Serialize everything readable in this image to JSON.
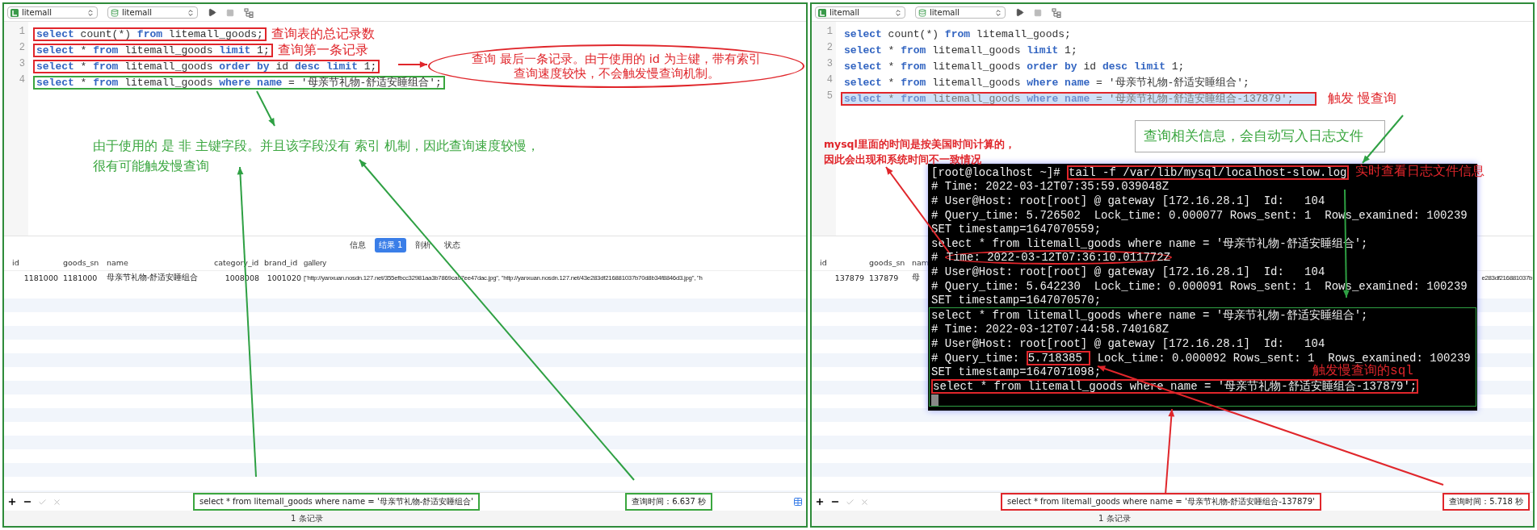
{
  "panels": [
    {
      "toolbar": {
        "connection": "litemall",
        "database": "litemall"
      },
      "editor": {
        "lines": [
          {
            "number": "1",
            "selected": false,
            "color": "#e0262b",
            "note": "查询表的总记录数",
            "text": "**select** count(*) **from** litemall_goods;"
          },
          {
            "number": "2",
            "selected": false,
            "color": "#e0262b",
            "note": "查询第一条记录",
            "text": "**select** * **from** litemall_goods **limit** 1;"
          },
          {
            "number": "3",
            "selected": false,
            "color": "#e0262b",
            "text": "**select** * **from** litemall_goods **order by** id **desc** **limit** 1;"
          },
          {
            "number": "4",
            "selected": false,
            "color": "#3aa63f",
            "text": "**select** * **from** litemall_goods **where** **name** = '母亲节礼物-舒适安睡组合';"
          }
        ]
      },
      "callouts": [
        {
          "kind": "ellipse",
          "color": "#e0262b",
          "lines": [
            "查询 最后一条记录。由于使用的 id 为主键，带有索引",
            "查询速度较快，不会触发慢查询机制。"
          ]
        },
        {
          "kind": "plain",
          "color": "#3aa63f",
          "lines": [
            "由于使用的 是 非 主键字段。并且该字段没有 索引 机制，因此查询速度较慢，",
            "很有可能触发慢查询"
          ]
        }
      ],
      "result_tabs": [
        {
          "label": "信息",
          "selected": false
        },
        {
          "label": "结果 1",
          "selected": true
        },
        {
          "label": "剖析",
          "selected": false
        },
        {
          "label": "状态",
          "selected": false
        }
      ],
      "table": {
        "columns": [
          "id",
          "goods_sn",
          "name",
          "category_id",
          "brand_id",
          "gallery"
        ],
        "rows": [
          {
            "cells": [
              "1181000",
              "1181000",
              "母亲节礼物-舒适安睡组合",
              "1008008",
              "1001020",
              "[\"http://yanxuan.nosdn.127.net/355efbcc32981aa3b7869ca07ee47dac.jpg\", \"http://yanxuan.nosdn.127.net/43e283df216881037b70d8b34f8846d3.jpg\", \"h"
            ]
          }
        ]
      },
      "footer": {
        "sql": "select * from litemall_goods where name = '母亲节礼物-舒适安睡组合'",
        "query_time": "查询时间：6.637 秒",
        "color": "#3aa63f"
      },
      "status": "1 条记录"
    },
    {
      "toolbar": {
        "connection": "litemall",
        "database": "litemall"
      },
      "editor": {
        "lines": [
          {
            "number": "1",
            "selected": false,
            "text": "**select** count(*) **from** litemall_goods;"
          },
          {
            "number": "2",
            "selected": false,
            "text": "**select** * **from** litemall_goods **limit** 1;"
          },
          {
            "number": "3",
            "selected": false,
            "text": "**select** * **from** litemall_goods **order by** id **desc** **limit** 1;"
          },
          {
            "number": "4",
            "selected": false,
            "text": "**select** * **from** litemall_goods **where** **name** = '母亲节礼物-舒适安睡组合';"
          },
          {
            "number": "5",
            "selected": true,
            "color": "#e0262b",
            "note": "触发 慢查询",
            "text": "**select** * **from** litemall_goods **where** **name** = '母亲节礼物-舒适安睡组合-137879';"
          }
        ]
      },
      "callouts": [
        {
          "kind": "bold",
          "color": "#e0262b",
          "lines": [
            "mysql里面的时间是按美国时间计算的，",
            "因此会出现和系统时间不一致情况"
          ]
        },
        {
          "kind": "boxed",
          "color": "#3aa63f",
          "lines": [
            "查询相关信息，会自动写入日志文件"
          ]
        }
      ],
      "table": {
        "columns": [
          "id",
          "goods_sn",
          "nam"
        ],
        "rows": [
          {
            "cells": [
              "137879",
              "137879",
              "母"
            ],
            "tail": "e283df216881037b"
          }
        ]
      },
      "footer": {
        "sql": "select * from litemall_goods where name = '母亲节礼物-舒适安睡组合-137879'",
        "query_time": "查询时间：5.718 秒",
        "color": "#e0262b"
      },
      "status": "1 条记录",
      "terminal": {
        "lines": [
          {
            "segments": [
              {
                "kind": "plain",
                "text": "[root@localhost ~]# "
              },
              {
                "kind": "boxed",
                "text": "tail -f /var/lib/mysql/localhost-slow.log"
              }
            ],
            "note": "实时查看日志文件信息"
          },
          {
            "segments": [
              {
                "kind": "plain",
                "text": "# Time: 2022-03-12T07:35:59.039048Z"
              }
            ]
          },
          {
            "segments": [
              {
                "kind": "plain",
                "text": "# User@Host: root[root] @ gateway [172.16.28.1]  Id:   104"
              }
            ]
          },
          {
            "segments": [
              {
                "kind": "plain",
                "text": "# Query_time: 5.726502  Lock_time: 0.000077 Rows_sent: 1  Rows_examined: 100239"
              }
            ]
          },
          {
            "segments": [
              {
                "kind": "plain",
                "text": "SET timestamp=1647070559;"
              }
            ]
          },
          {
            "segments": [
              {
                "kind": "plain",
                "text": "select * from litemall_goods where name = '母亲节礼物-舒适安睡组合';"
              }
            ]
          },
          {
            "segments": [
              {
                "kind": "plain",
                "text": "# "
              },
              {
                "kind": "circled",
                "text": "Time: 2022-03-12T07:36:10.011772Z"
              }
            ]
          },
          {
            "segments": [
              {
                "kind": "plain",
                "text": "# User@Host: root[root] @ gateway [172.16.28.1]  Id:   104"
              }
            ]
          },
          {
            "segments": [
              {
                "kind": "plain",
                "text": "# Query_time: 5.642230  Lock_time: 0.000091 Rows_sent: 1  Rows_examined: 100239"
              }
            ]
          },
          {
            "segments": [
              {
                "kind": "plain",
                "text": "SET timestamp=1647070570;"
              }
            ]
          }
        ],
        "group": [
          {
            "segments": [
              {
                "kind": "plain",
                "text": "select * from litemall_goods where name = '母亲节礼物-舒适安睡组合';"
              }
            ]
          },
          {
            "segments": [
              {
                "kind": "plain",
                "text": "# Time: 2022-03-12T07:44:58.740168Z"
              }
            ]
          },
          {
            "segments": [
              {
                "kind": "plain",
                "text": "# User@Host: root[root] @ gateway [172.16.28.1]  Id:   104"
              }
            ]
          },
          {
            "segments": [
              {
                "kind": "plain",
                "text": "# Query_time: "
              },
              {
                "kind": "boxed",
                "text": "5.718385 "
              },
              {
                "kind": "plain",
                "text": " Lock_time: 0.000092 Rows_sent: 1  Rows_examined: 100239"
              }
            ]
          },
          {
            "segments": [
              {
                "kind": "plain",
                "text": "SET timestamp=1647071098;"
              }
            ],
            "note": "触发慢查询的sql"
          },
          {
            "segments": [
              {
                "kind": "boxed",
                "text": "select * from litemall_goods where name = '母亲节礼物-舒适安睡组合-137879';"
              }
            ]
          }
        ]
      }
    }
  ]
}
